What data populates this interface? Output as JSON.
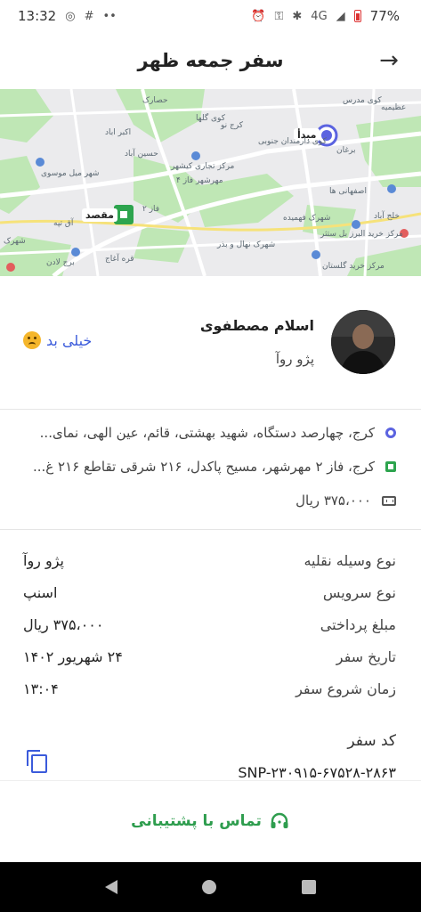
{
  "status_bar": {
    "time": "13:32",
    "network": "4G",
    "battery": "77%"
  },
  "header": {
    "title": "سفر جمعه ظهر",
    "back_icon": "arrow-right-icon"
  },
  "map": {
    "origin_label": "مبدأ",
    "destination_label": "مقصد",
    "place_labels": [
      "کوی مدرس",
      "عظیمیه",
      "حصارک",
      "کوی گلها",
      "اکبر اباد",
      "کرج نو",
      "برغان",
      "حسین آباد",
      "کوی دارمندان جنوبی",
      "مرکز تجاری کیشهر",
      "مهرشهر فاز ۴",
      "اصفهانی ها",
      "شهر میل موسوی",
      "فاز ۲",
      "خلج آباد",
      "شهرک فهمیده",
      "مرکز خرید البرز بل ستثر",
      "آق تپه",
      "شهرک",
      "شهرک نهال و بذر",
      "برج لادن",
      "قره آغاج",
      "مرکز خرید گلستان"
    ]
  },
  "driver": {
    "name": "اسلام مصطفوی",
    "car": "پژو روآ",
    "rating_label": "خیلی بد"
  },
  "route": {
    "origin": "کرج، چهارصد دستگاه، شهید بهشتی، قائم، عین الهی، نمای...",
    "destination": "کرج، فاز ۲ مهرشهر، مسیح پاکدل، ۲۱۶ شرقی تقاطع ۲۱۶ غ...",
    "price": "۳۷۵،۰۰۰ ریال"
  },
  "details": [
    {
      "key": "نوع وسیله نقلیه",
      "value": "پژو روآ"
    },
    {
      "key": "نوع سرویس",
      "value": "اسنپ"
    },
    {
      "key": "مبلغ پرداختی",
      "value": "۳۷۵،۰۰۰ ریال"
    },
    {
      "key": "تاریخ سفر",
      "value": "۲۴ شهریور ۱۴۰۲"
    },
    {
      "key": "زمان شروع سفر",
      "value": "۱۳:۰۴"
    }
  ],
  "trip_code": {
    "label": "کد سفر",
    "value": "SNP-۲۳۰۹۱۵-۶۷۵۲۸-۲۸۶۳"
  },
  "support": {
    "label": "تماس با پشتیبانی"
  },
  "colors": {
    "accent_blue": "#3b5bdb",
    "origin_dot": "#5b63e0",
    "destination_green": "#2da44e",
    "support_green": "#2e9d4e"
  }
}
